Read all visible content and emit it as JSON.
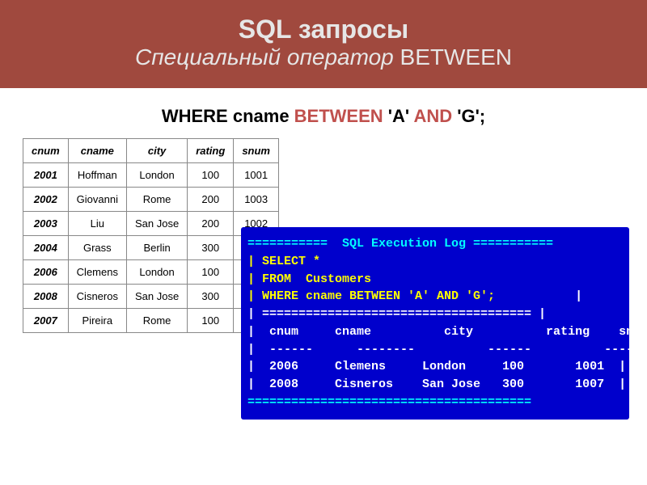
{
  "title": {
    "line1": "SQL запросы",
    "line2_prefix": "Специальный оператор",
    "line2_kw": " BETWEEN"
  },
  "where": {
    "where": "WHERE ",
    "col": "cname ",
    "between": "BETWEEN ",
    "litA": "'A' ",
    "and": "AND ",
    "litG": "'G';"
  },
  "table": {
    "headers": [
      "cnum",
      "cname",
      "city",
      "rating",
      "snum"
    ],
    "rows": [
      [
        "2001",
        "Hoffman",
        "London",
        "100",
        "1001"
      ],
      [
        "2002",
        "Giovanni",
        "Rome",
        "200",
        "1003"
      ],
      [
        "2003",
        "Liu",
        "San Jose",
        "200",
        "1002"
      ],
      [
        "2004",
        "Grass",
        "Berlin",
        "300",
        ""
      ],
      [
        "2006",
        "Clemens",
        "London",
        "100",
        ""
      ],
      [
        "2008",
        "Cisneros",
        "San Jose",
        "300",
        ""
      ],
      [
        "2007",
        "Pireira",
        "Rome",
        "100",
        ""
      ]
    ]
  },
  "log": {
    "rule_top": "===========  SQL Execution Log ===========",
    "l1a": "| SELECT *",
    "l1b": "                                                    |",
    "l2a": "| FROM  Customers",
    "l2b": "                                       |",
    "l3a": "| WHERE cname BETWEEN 'A' AND 'G';",
    "l3b": "           |",
    "rule_mid": "| ===================================== |",
    "hcols": "|  cnum     cname          city          rating    snum  |",
    "hsep": "|  ------      --------          ------          ----       ------  |",
    "r1": "|  2006     Clemens     London     100       1001  |",
    "r2": "|  2008     Cisneros    San Jose   300       1007  |",
    "rule_bot": "======================================="
  }
}
